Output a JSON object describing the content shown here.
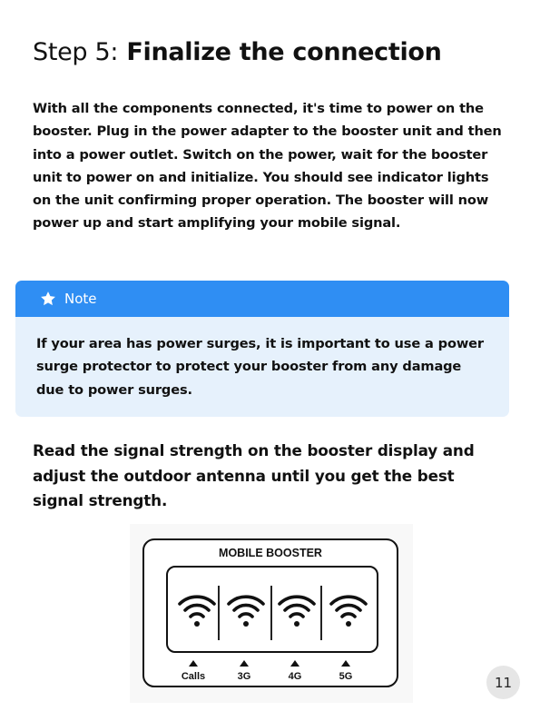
{
  "heading": {
    "prefix": "Step 5:",
    "title": "Finalize the connection"
  },
  "intro": "With all the components connected, it's time to power on the booster. Plug in the power adapter to the booster unit and then into a power outlet. Switch on the power, wait for the booster unit to power on and initialize. You should see indicator lights on the unit confirming proper operation.  The booster will now power up and start amplifying your mobile signal.",
  "note": {
    "icon": "star-icon",
    "label": "Note",
    "text": "If your area has power surges, it is important to use a power surge protector to protect your booster from any damage due to power surges."
  },
  "instruction": "Read the signal strength on the booster display and adjust the outdoor antenna until you get the best signal strength.",
  "booster": {
    "title": "MOBILE BOOSTER",
    "bands": [
      {
        "label": "Calls",
        "icon": "wifi-signal-icon"
      },
      {
        "label": "3G",
        "icon": "wifi-signal-icon"
      },
      {
        "label": "4G",
        "icon": "wifi-signal-icon"
      },
      {
        "label": "5G",
        "icon": "wifi-signal-icon"
      }
    ]
  },
  "page_number": "11",
  "colors": {
    "note_header": "#2f8ef3",
    "note_body": "#e6f1fc",
    "text": "#111111",
    "page_badge": "#e6e6e6"
  }
}
